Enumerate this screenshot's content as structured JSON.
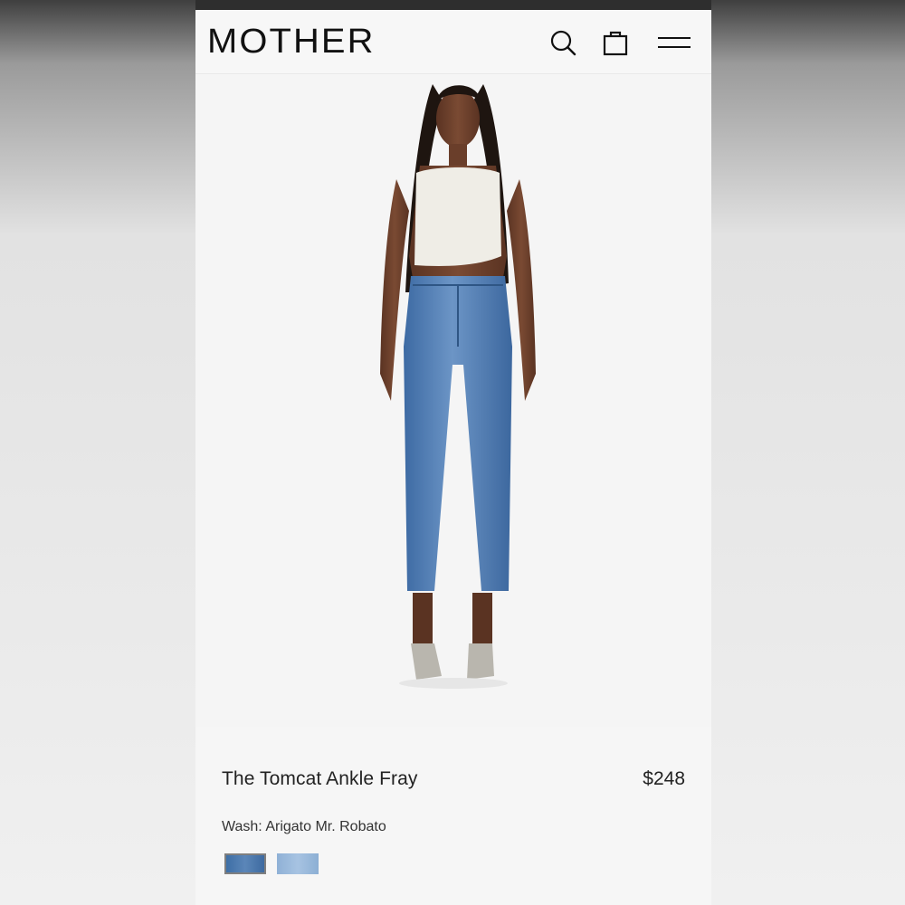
{
  "header": {
    "logo": "MOTHER",
    "icons": [
      "search-icon",
      "shopping-bag-icon",
      "hamburger-menu-icon"
    ]
  },
  "product": {
    "name": "The Tomcat Ankle Fray",
    "price": "$248",
    "wash_label": "Wash: Arigato Mr. Robato",
    "swatches": [
      {
        "color": "#4a78ae",
        "selected": true
      },
      {
        "color": "#9bbbe0",
        "selected": false
      }
    ]
  },
  "colors": {
    "text": "#222222",
    "background": "#f6f6f6",
    "status_strip": "#2e2e2e"
  }
}
